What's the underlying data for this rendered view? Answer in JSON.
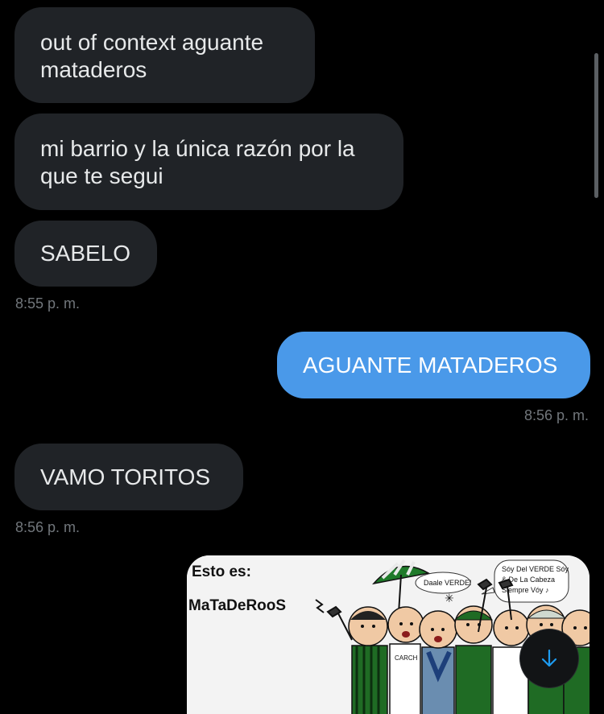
{
  "messages": [
    {
      "text_line1": "out of context aguante",
      "text_line2": "mataderos"
    },
    {
      "text_line1": "mi barrio y la única razón por la",
      "text_line2": "que te segui"
    },
    {
      "text": "SABELO",
      "time": "8:55 p. m."
    },
    {
      "text": "AGUANTE MATADEROS",
      "time": "8:56 p. m."
    },
    {
      "text": "VAMO TORITOS",
      "time": "8:56 p. m."
    }
  ],
  "media": {
    "caption_line1": "Esto es:",
    "caption_line2": "MaTaDeRooS",
    "shout_1": "Daale VERDE!",
    "speech_line1": "Sóy Del VERDE Sóy",
    "speech_line2": "& De La Cabeza",
    "speech_line3": "Siempre Vóy ♪",
    "shirt_text": "CARCH"
  },
  "colors": {
    "background": "#000000",
    "incoming_bubble": "#202327",
    "outgoing_bubble": "#4a99e9",
    "timestamp": "#71767b",
    "accent": "#1d9bf0"
  },
  "icons": {
    "scroll_down": "arrow-down-icon"
  }
}
